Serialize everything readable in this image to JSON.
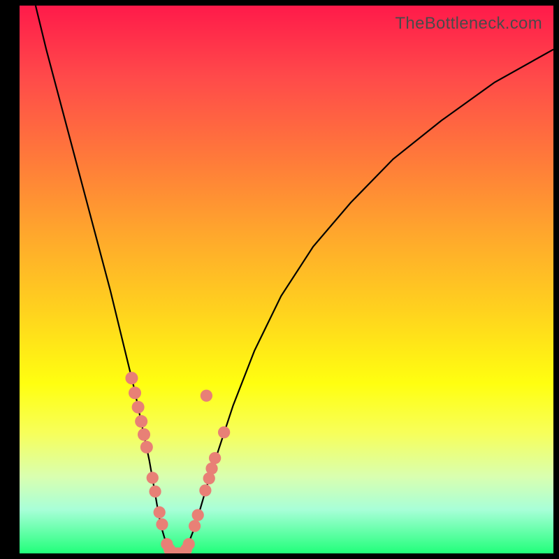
{
  "watermark": "TheBottleneck.com",
  "chart_data": {
    "type": "line",
    "title": "",
    "xlabel": "",
    "ylabel": "",
    "xlim": [
      0,
      100
    ],
    "ylim": [
      0,
      100
    ],
    "series": [
      {
        "name": "left-branch",
        "x": [
          3,
          5,
          8,
          11,
          14,
          17,
          19.5,
          21.5,
          23,
          24.3,
          25.2,
          25.9,
          26.5,
          27.1,
          27.6,
          28.1,
          28.6
        ],
        "y": [
          100,
          92,
          81,
          70,
          59,
          48,
          38,
          30,
          23,
          17,
          12,
          8,
          5,
          3,
          1.5,
          0.4,
          0
        ]
      },
      {
        "name": "valley-floor",
        "x": [
          28.6,
          29.3,
          30.0,
          30.7
        ],
        "y": [
          0,
          0,
          0,
          0
        ]
      },
      {
        "name": "right-branch",
        "x": [
          30.7,
          31.5,
          32.5,
          33.8,
          35.3,
          37.3,
          40,
          44,
          49,
          55,
          62,
          70,
          79,
          89,
          100
        ],
        "y": [
          0,
          1.5,
          4,
          8,
          13,
          19,
          27,
          37,
          47,
          56,
          64,
          72,
          79,
          86,
          92
        ]
      }
    ],
    "points": [
      {
        "x": 21.0,
        "y": 32.0,
        "r": 1.0
      },
      {
        "x": 21.6,
        "y": 29.3,
        "r": 1.0
      },
      {
        "x": 22.2,
        "y": 26.7,
        "r": 1.0
      },
      {
        "x": 22.8,
        "y": 24.1,
        "r": 1.0
      },
      {
        "x": 23.3,
        "y": 21.7,
        "r": 1.0
      },
      {
        "x": 23.8,
        "y": 19.4,
        "r": 1.0
      },
      {
        "x": 24.9,
        "y": 13.8,
        "r": 0.9
      },
      {
        "x": 25.4,
        "y": 11.3,
        "r": 0.9
      },
      {
        "x": 26.2,
        "y": 7.5,
        "r": 0.9
      },
      {
        "x": 26.7,
        "y": 5.3,
        "r": 0.9
      },
      {
        "x": 27.6,
        "y": 1.7,
        "r": 0.9
      },
      {
        "x": 28.1,
        "y": 0.7,
        "r": 0.9
      },
      {
        "x": 28.5,
        "y": 0.1,
        "r": 0.9
      },
      {
        "x": 29.0,
        "y": 0.0,
        "r": 0.9
      },
      {
        "x": 29.6,
        "y": 0.0,
        "r": 0.9
      },
      {
        "x": 30.2,
        "y": 0.0,
        "r": 0.9
      },
      {
        "x": 30.7,
        "y": 0.1,
        "r": 0.9
      },
      {
        "x": 31.2,
        "y": 0.7,
        "r": 0.9
      },
      {
        "x": 31.7,
        "y": 1.7,
        "r": 0.9
      },
      {
        "x": 32.8,
        "y": 5.0,
        "r": 0.9
      },
      {
        "x": 33.4,
        "y": 7.0,
        "r": 0.9
      },
      {
        "x": 34.8,
        "y": 11.5,
        "r": 0.9
      },
      {
        "x": 35.5,
        "y": 13.7,
        "r": 0.9
      },
      {
        "x": 36.0,
        "y": 15.5,
        "r": 0.9
      },
      {
        "x": 36.6,
        "y": 17.4,
        "r": 0.9
      },
      {
        "x": 38.3,
        "y": 22.1,
        "r": 0.9
      },
      {
        "x": 35.0,
        "y": 28.8,
        "r": 0.9
      }
    ]
  }
}
